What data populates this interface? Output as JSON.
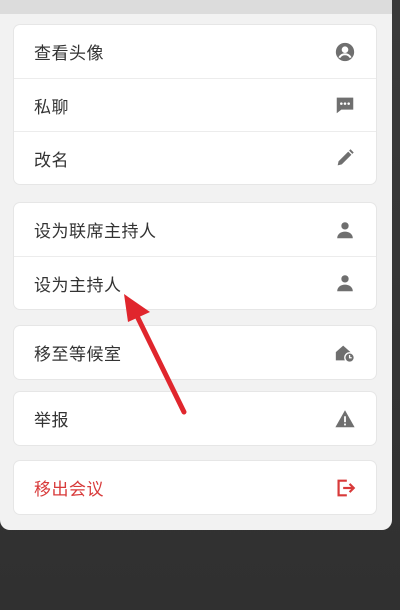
{
  "menu": {
    "group1": [
      {
        "label": "查看头像",
        "icon": "user-circle-icon"
      },
      {
        "label": "私聊",
        "icon": "chat-bubble-icon"
      },
      {
        "label": "改名",
        "icon": "pencil-icon"
      }
    ],
    "group2": [
      {
        "label": "设为联席主持人",
        "icon": "person-icon"
      },
      {
        "label": "设为主持人",
        "icon": "person-icon"
      }
    ],
    "group3": [
      {
        "label": "移至等候室",
        "icon": "waiting-room-icon"
      }
    ],
    "group4": [
      {
        "label": "举报",
        "icon": "warning-icon"
      }
    ],
    "group5": [
      {
        "label": "移出会议",
        "icon": "exit-icon"
      }
    ]
  },
  "colors": {
    "danger": "#d83a3a",
    "icon": "#6f6f6f",
    "arrow": "#e0262d"
  }
}
